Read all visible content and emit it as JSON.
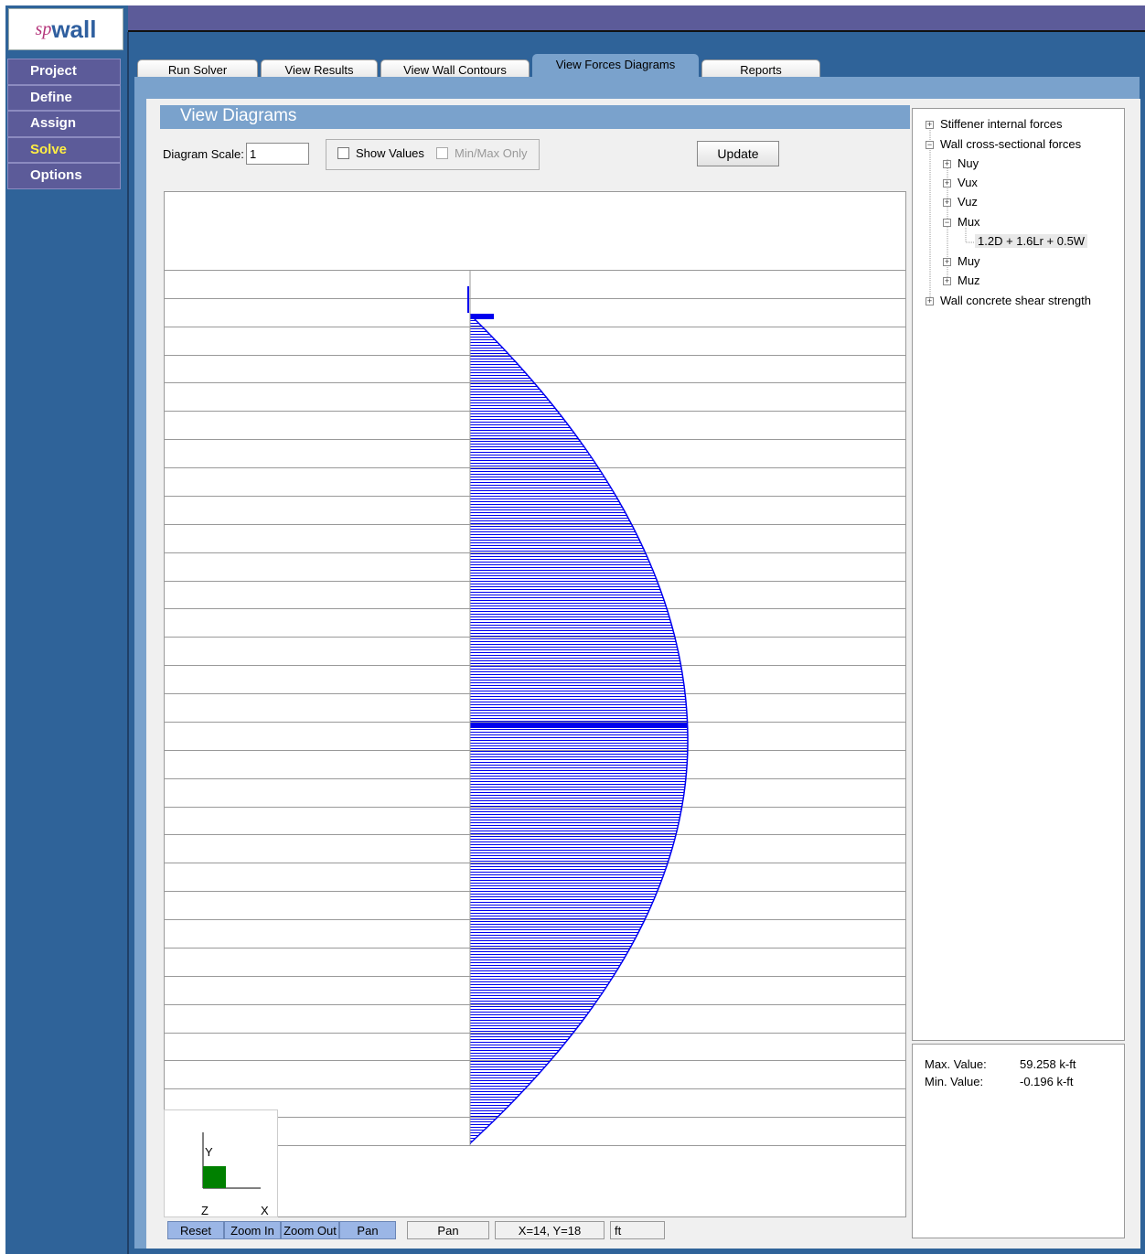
{
  "app": {
    "logo_prefix": "sp",
    "logo_suffix": "wall"
  },
  "menu": [
    {
      "label": "Project",
      "active": false
    },
    {
      "label": "Define",
      "active": false
    },
    {
      "label": "Assign",
      "active": false
    },
    {
      "label": "Solve",
      "active": true
    },
    {
      "label": "Options",
      "active": false
    }
  ],
  "tabs": [
    {
      "label": "Run Solver",
      "active": false
    },
    {
      "label": "View Results",
      "active": false
    },
    {
      "label": "View Wall Contours",
      "active": false
    },
    {
      "label": "View Forces Diagrams",
      "active": true
    },
    {
      "label": "Reports",
      "active": false
    }
  ],
  "view_diagrams": {
    "title": "View Diagrams",
    "scale_label": "Diagram Scale:",
    "scale_value": "1",
    "show_values_label": "Show Values",
    "show_values_checked": false,
    "minmax_only_label": "Min/Max Only",
    "minmax_only_checked": false,
    "update_label": "Update"
  },
  "diagram": {
    "fill_color": "#0000ee",
    "max_value": 59.258,
    "axis_labels": {
      "y": "Y",
      "z": "Z",
      "x": "X"
    }
  },
  "tree": {
    "items": [
      {
        "label": "Stiffener internal forces",
        "level": 0,
        "expander": "+"
      },
      {
        "label": "Wall cross-sectional forces",
        "level": 0,
        "expander": "-"
      },
      {
        "label": "Nuy",
        "level": 1,
        "expander": "+"
      },
      {
        "label": "Vux",
        "level": 1,
        "expander": "+"
      },
      {
        "label": "Vuz",
        "level": 1,
        "expander": "+"
      },
      {
        "label": "Mux",
        "level": 1,
        "expander": "-"
      },
      {
        "label": "1.2D + 1.6Lr + 0.5W",
        "level": 2,
        "expander": "",
        "selected": true
      },
      {
        "label": "Muy",
        "level": 1,
        "expander": "+"
      },
      {
        "label": "Muz",
        "level": 1,
        "expander": "+"
      },
      {
        "label": "Wall concrete shear strength",
        "level": 0,
        "expander": "+"
      }
    ]
  },
  "results": {
    "max_label": "Max. Value:",
    "max_value": "59.258 k-ft",
    "min_label": "Min. Value:",
    "min_value": "-0.196 k-ft"
  },
  "toolbar": {
    "reset_label": "Reset",
    "zoom_in_label": "Zoom In",
    "zoom_out_label": "Zoom Out",
    "pan_label": "Pan",
    "mode_text": "Pan",
    "coords_text": "X=14, Y=18",
    "units_text": "ft"
  }
}
